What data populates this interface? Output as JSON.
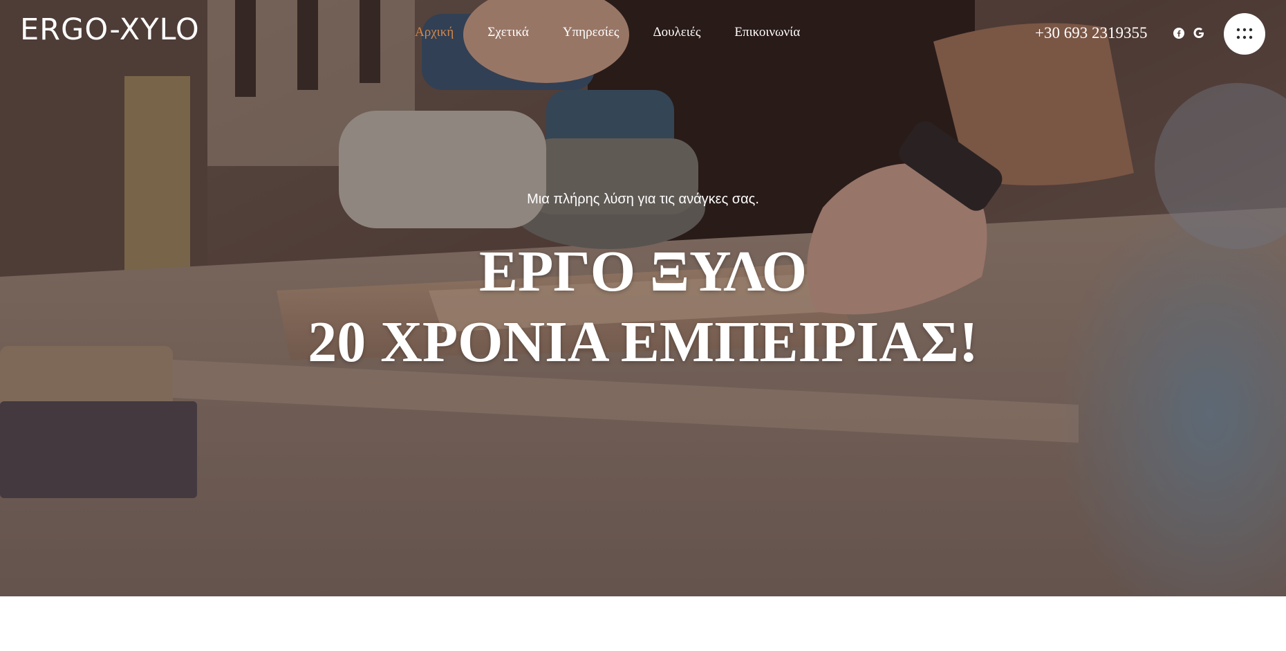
{
  "brand": {
    "logo_text": "ERGO-XYLO"
  },
  "nav": {
    "items": [
      {
        "label": "Αρχική",
        "active": true
      },
      {
        "label": "Σχετικά",
        "active": false
      },
      {
        "label": "Υπηρεσίες",
        "active": false
      },
      {
        "label": "Δουλειές",
        "active": false
      },
      {
        "label": "Επικοινωνία",
        "active": false
      }
    ]
  },
  "header": {
    "phone": "+30 693 2319355",
    "social_icons": [
      "facebook-icon",
      "google-icon"
    ],
    "menu_icon": "grid-dots-icon"
  },
  "hero": {
    "subtitle": "Μια πλήρης λύση για τις ανάγκες σας.",
    "headline_line1": "ΕΡΓΟ ΞΥΛΟ",
    "headline_line2": "20 ΧΡΟΝΙΑ ΕΜΠΕΙΡΙΑΣ!"
  },
  "colors": {
    "accent": "#d4874a",
    "text": "#ffffff",
    "page_background": "#ffffff"
  }
}
